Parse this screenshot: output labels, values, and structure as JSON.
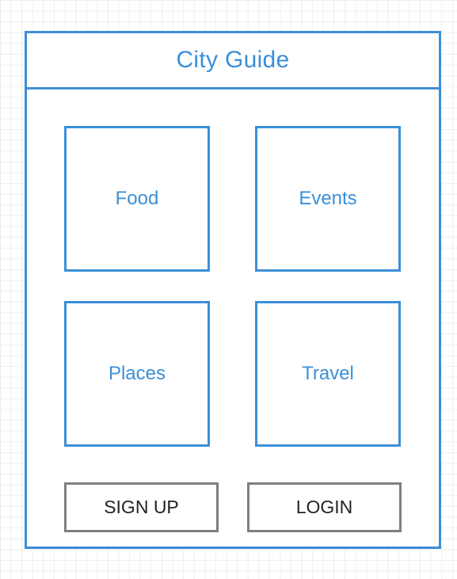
{
  "header": {
    "title": "City Guide"
  },
  "tiles": [
    {
      "label": "Food"
    },
    {
      "label": "Events"
    },
    {
      "label": "Places"
    },
    {
      "label": "Travel"
    }
  ],
  "actions": {
    "signup_label": "SIGN UP",
    "login_label": "LOGIN"
  },
  "colors": {
    "accent": "#3b8fd8",
    "button_border": "#7f7f7f",
    "grid": "#eeeeee"
  }
}
